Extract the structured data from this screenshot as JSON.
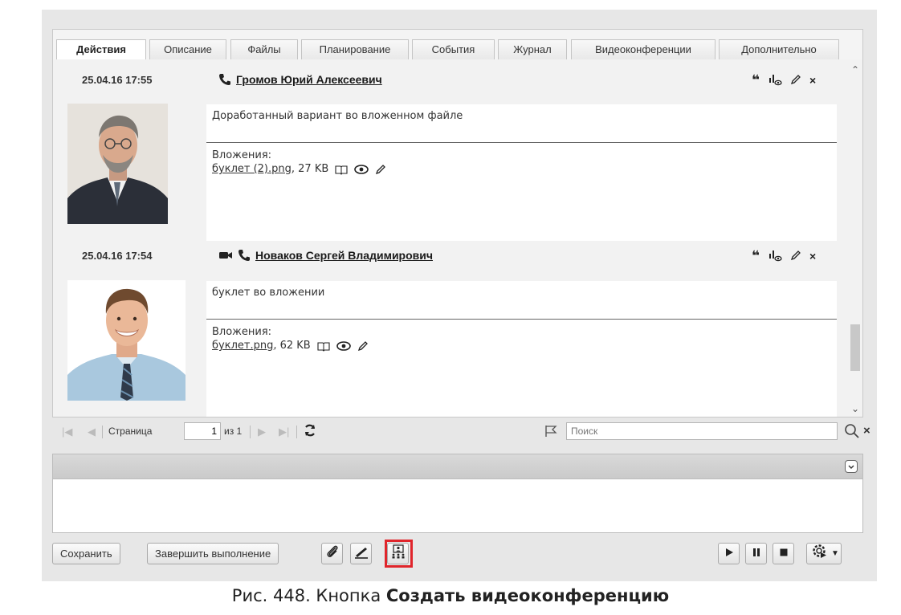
{
  "tabs": [
    {
      "label": "Действия",
      "active": true
    },
    {
      "label": "Описание"
    },
    {
      "label": "Файлы"
    },
    {
      "label": "Планирование"
    },
    {
      "label": "События"
    },
    {
      "label": "Журнал"
    },
    {
      "label": "Видеоконференции"
    },
    {
      "label": "Дополнительно"
    }
  ],
  "messages": [
    {
      "date": "25.04.16 17:55",
      "author": "Громов Юрий Алексеевич",
      "author_icons": [
        "phone-icon"
      ],
      "text": "Доработанный вариант во вложенном файле",
      "attachments_label": "Вложения:",
      "attachment_name": "буклет (2).png",
      "attachment_size": ", 27 KB"
    },
    {
      "date": "25.04.16 17:54",
      "author": "Новаков Сергей Владимирович",
      "author_icons": [
        "video-camera-icon",
        "phone-icon"
      ],
      "text": "буклет во вложении",
      "attachments_label": "Вложения:",
      "attachment_name": "буклет.png",
      "attachment_size": ", 62 KB"
    }
  ],
  "pager": {
    "page_label": "Страница",
    "page_value": "1",
    "of_label": "из 1",
    "search_placeholder": "Поиск"
  },
  "toolbar": {
    "save_label": "Сохранить",
    "finish_label": "Завершить выполнение"
  },
  "caption": {
    "prefix": "Рис. 448. Кнопка ",
    "bold": "Создать видеоконференцию"
  },
  "colors": {
    "highlight": "#e0252b",
    "background": "#e7e7e7"
  }
}
